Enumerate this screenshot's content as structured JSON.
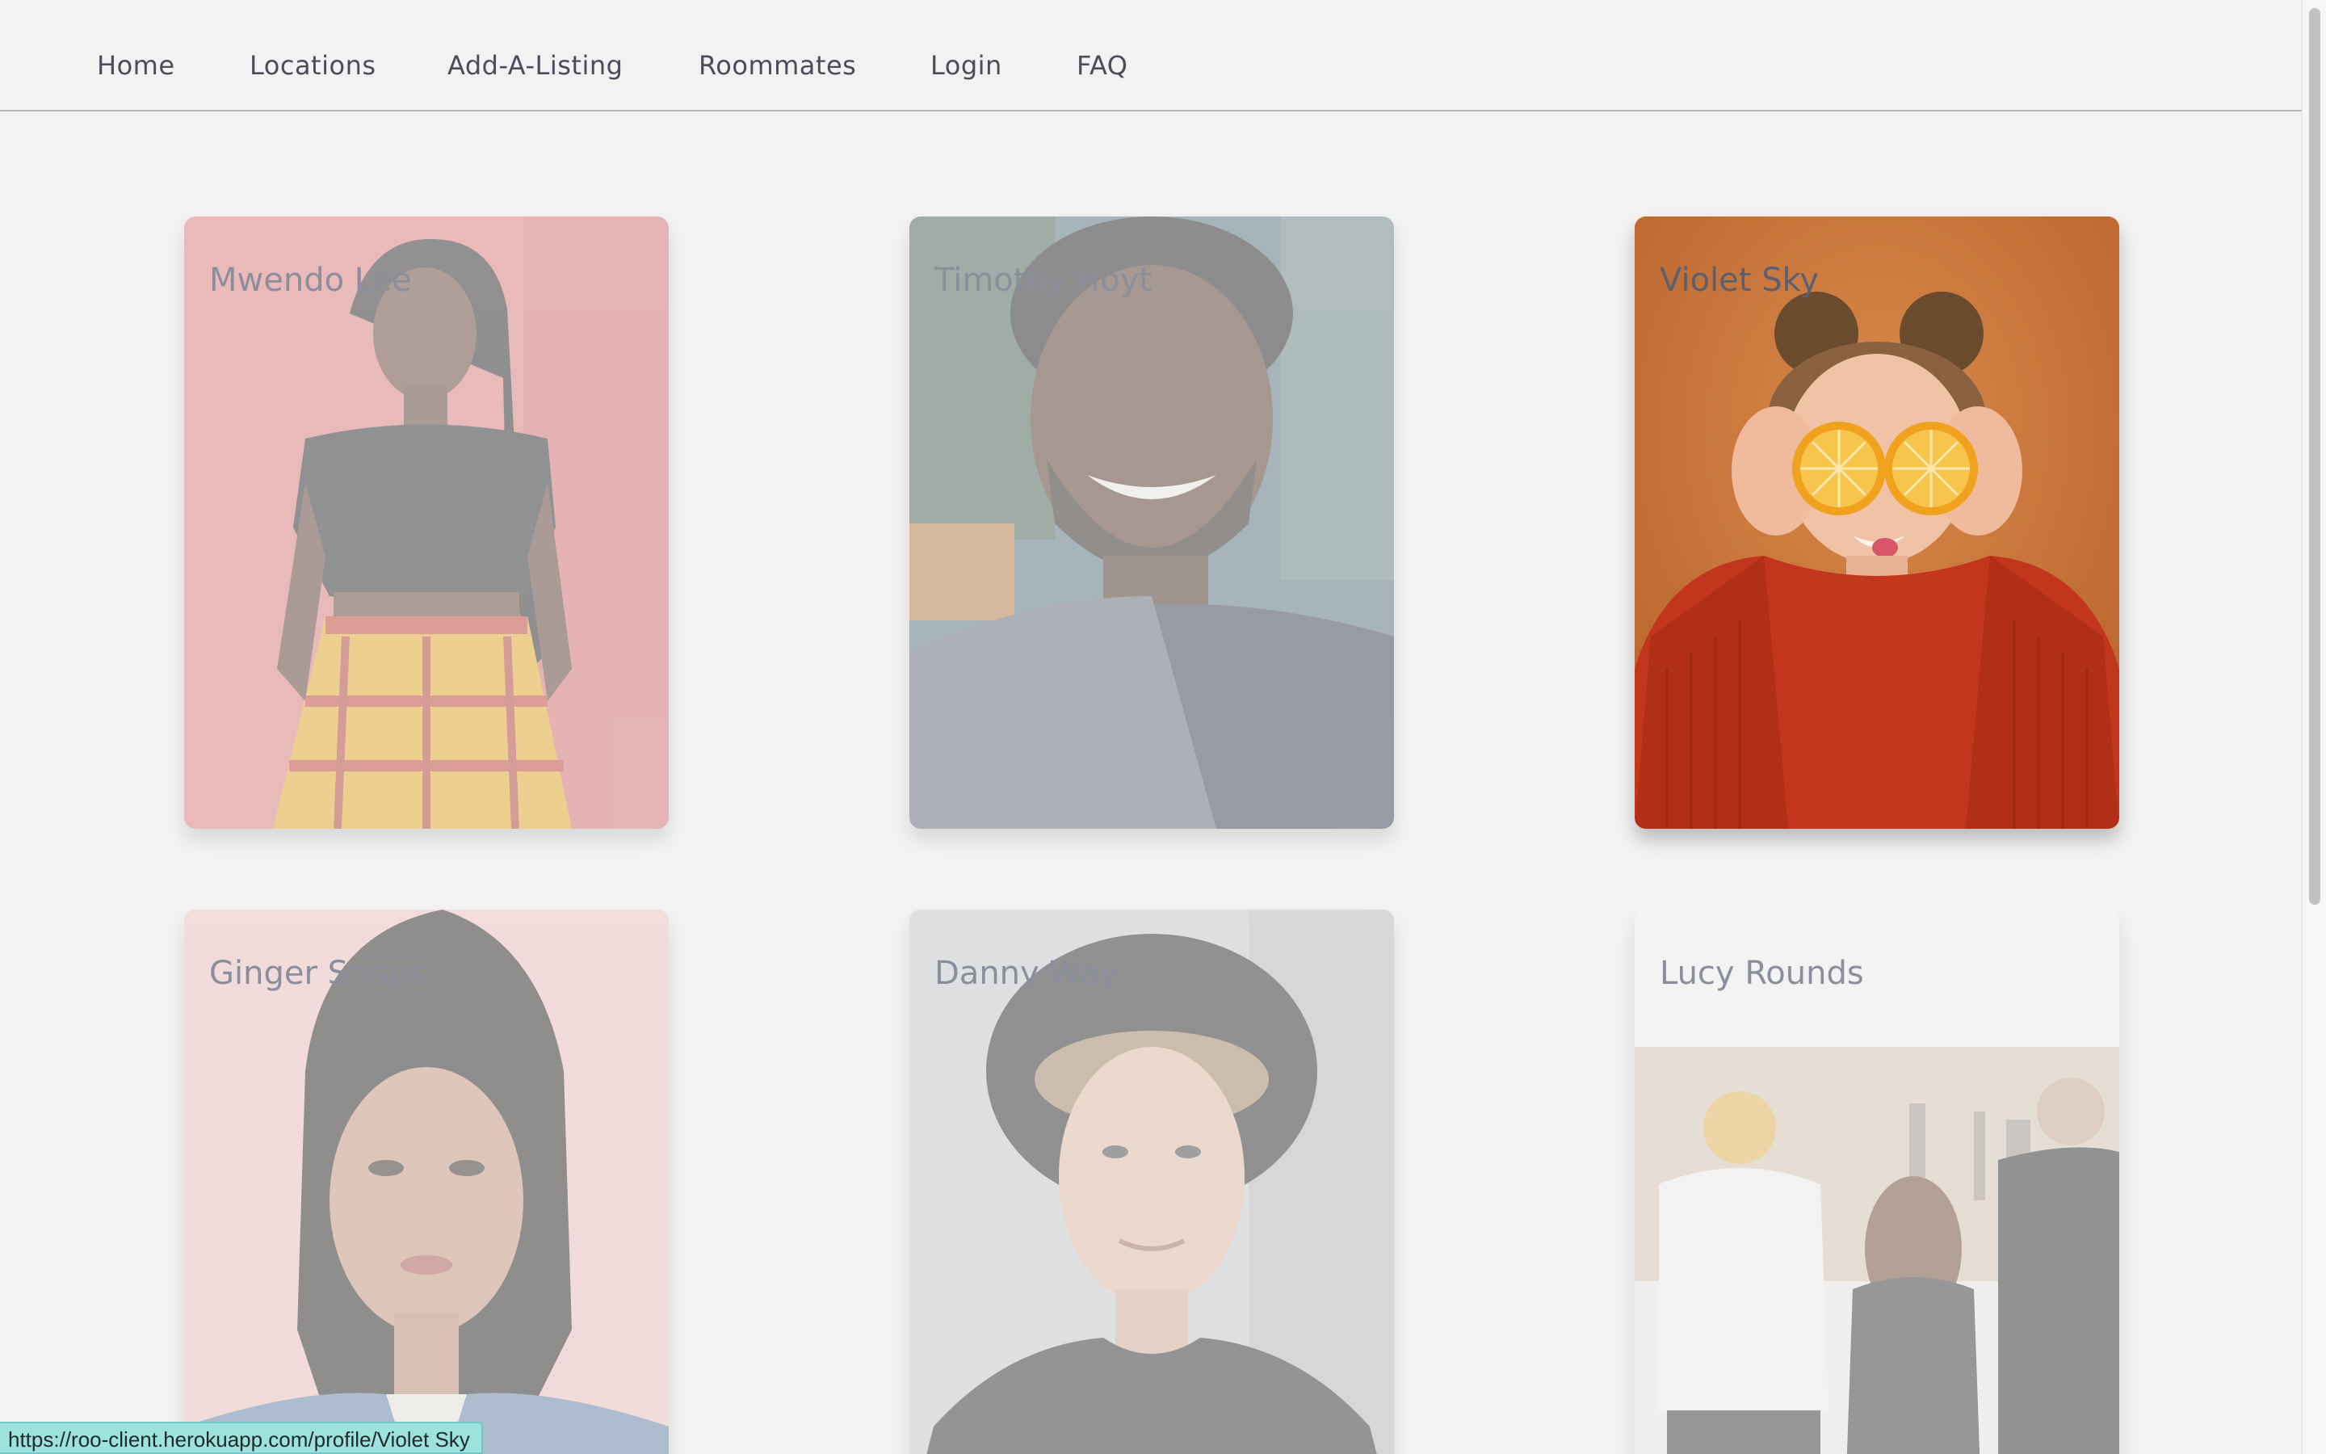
{
  "nav": {
    "items": [
      {
        "label": "Home"
      },
      {
        "label": "Locations"
      },
      {
        "label": "Add-A-Listing"
      },
      {
        "label": "Roommates"
      },
      {
        "label": "Login"
      },
      {
        "label": "FAQ"
      }
    ]
  },
  "profiles": [
    {
      "name": "Mwendo Lee",
      "state": "faded"
    },
    {
      "name": "Timothy Hoyt",
      "state": "faded"
    },
    {
      "name": "Violet Sky",
      "state": "hovered"
    },
    {
      "name": "Ginger Snaps",
      "state": "faded"
    },
    {
      "name": "Danny Way",
      "state": "faded"
    },
    {
      "name": "Lucy Rounds",
      "state": "faded"
    }
  ],
  "status_bar": {
    "url": "https://roo-client.herokuapp.com/profile/Violet Sky"
  },
  "colors": {
    "background": "#f2f2f2",
    "nav_text": "#4a4d59",
    "status_bar": "#9ee2de"
  }
}
